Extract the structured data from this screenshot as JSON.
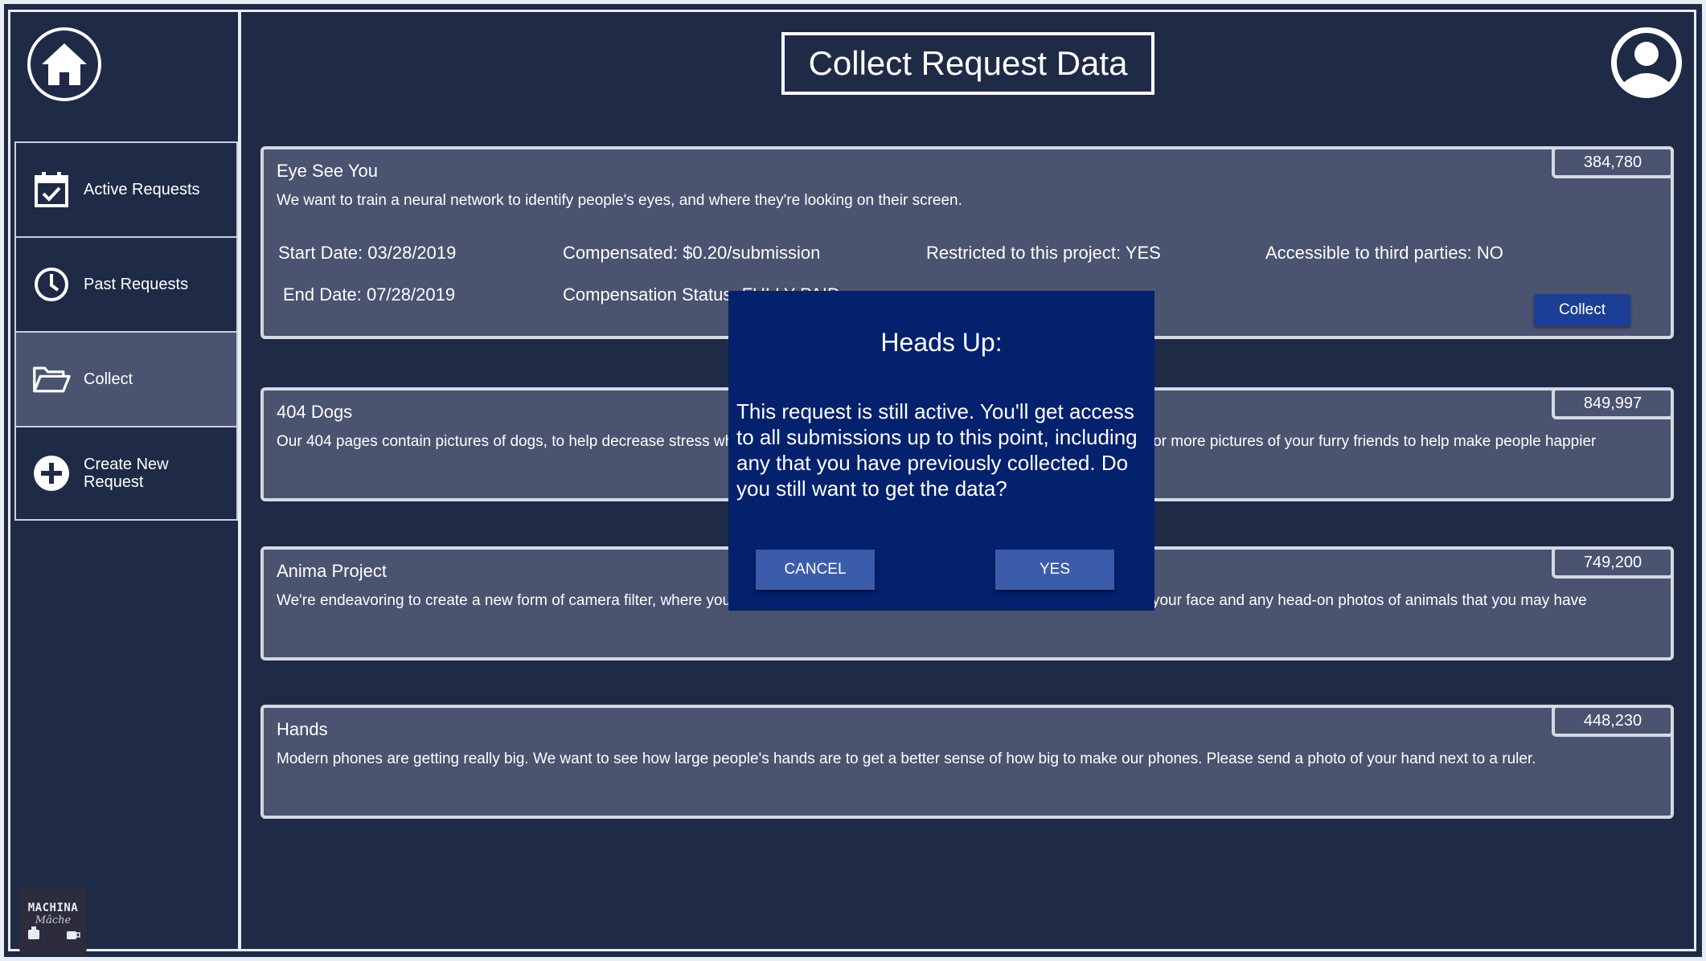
{
  "header": {
    "title": "Collect Request Data"
  },
  "sidebar": {
    "items": [
      {
        "label": "Active Requests",
        "icon": "calendar-check-icon"
      },
      {
        "label": "Past Requests",
        "icon": "clock-icon"
      },
      {
        "label": "Collect",
        "icon": "folder-open-icon"
      },
      {
        "label": "Create New\nRequest",
        "icon": "plus-circle-icon"
      }
    ],
    "logo": {
      "line1": "MACHINA",
      "line2": "Mâche"
    }
  },
  "requests": [
    {
      "title": "Eye See You",
      "description": "We want to train a neural network to identify people's eyes, and where they're looking on their screen.",
      "count": "384,780",
      "start_date": "Start Date: 03/28/2019",
      "end_date": "End Date: 07/28/2019",
      "compensated": "Compensated: $0.20/submission",
      "compensation_status": "Compensation Status: FULLY PAID",
      "restricted": "Restricted to this project: YES",
      "third_parties": "Accessible to third parties: NO",
      "collect_label": "Collect"
    },
    {
      "title": "404 Dogs",
      "description": "Our 404 pages contain pictures of dogs, to help decrease stress when users find themselves on an unknown page. We're asking for more pictures of your furry friends to help make people happier",
      "count": "849,997"
    },
    {
      "title": "Anima Project",
      "description": "We're endeavoring to create a new form of camera filter, where your face is morphed with an animal. Please send us an image of your face and any head-on photos of animals that you may have",
      "count": "749,200"
    },
    {
      "title": "Hands",
      "description": "Modern phones are getting really big. We want to see how large people's hands are to get a better sense of how big to make our phones. Please send a photo of your hand next to a ruler.",
      "count": "448,230"
    }
  ],
  "modal": {
    "title": "Heads Up:",
    "message": "This request is still active. You'll get access to all submissions up to this point, including any that you have previously collected. Do you still want to get the data?",
    "cancel_label": "CANCEL",
    "yes_label": "YES"
  },
  "colors": {
    "background": "#1f2a47",
    "card": "#4a5370",
    "modal": "#04216e",
    "modal_button": "#3b5cab",
    "collect_button": "#1c3f95"
  }
}
